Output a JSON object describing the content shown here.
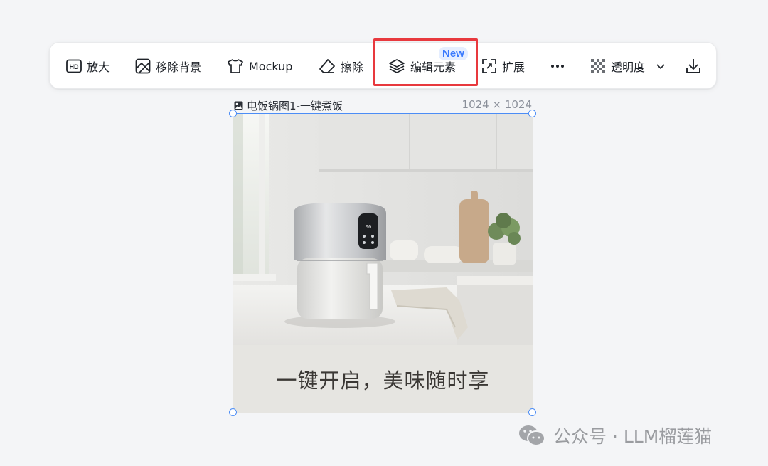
{
  "toolbar": {
    "upscale": "放大",
    "remove_bg": "移除背景",
    "mockup": "Mockup",
    "erase": "擦除",
    "edit_elements": "编辑元素",
    "new_badge": "New",
    "expand": "扩展",
    "transparency": "透明度",
    "hd_glyph": "HD"
  },
  "image": {
    "title": "电饭锅图1-一键煮饭",
    "dimensions": "1024 × 1024",
    "caption": "一键开启，美味随时享",
    "panel_text": "00"
  },
  "watermark": {
    "text": "公众号 · LLM榴莲猫"
  },
  "colors": {
    "highlight": "#e8393e",
    "selection": "#4c8df6",
    "badge_text": "#3a7afe"
  }
}
